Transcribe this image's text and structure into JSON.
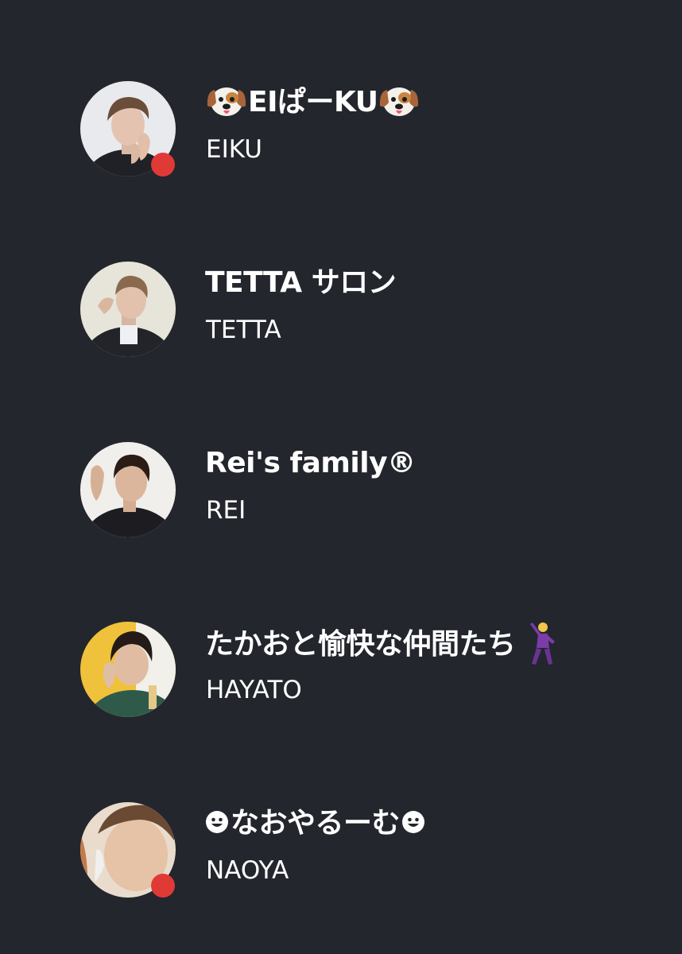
{
  "colors": {
    "background": "#23262d",
    "text": "#ffffff",
    "live_indicator": "#e03a36"
  },
  "rows": [
    {
      "title_prefix_icon": "dog-face-icon",
      "title": "EIぱーKU",
      "title_suffix_icon": "dog-face-icon",
      "subtitle": "EIKU",
      "live": true
    },
    {
      "title": "TETTA サロン",
      "subtitle": "TETTA",
      "live": false
    },
    {
      "title": "Rei's family®",
      "subtitle": "REI",
      "live": false
    },
    {
      "title": "たかおと愉快な仲間たち",
      "title_suffix_icon": "dancing-man-icon",
      "subtitle": "HAYATO",
      "live": false
    },
    {
      "title_prefix_icon": "smiley-face-icon",
      "title": "なおやるーむ",
      "title_suffix_icon": "smiley-face-icon",
      "subtitle": "NAOYA",
      "live": true
    }
  ]
}
